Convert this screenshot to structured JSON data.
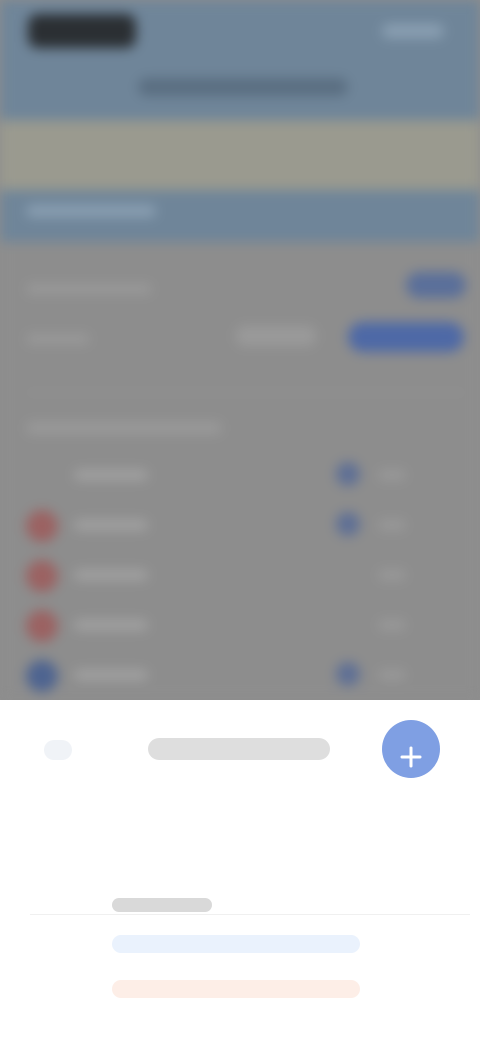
{
  "header": {
    "title": ""
  },
  "sheet": {
    "title": "",
    "section_label": "",
    "fab_icon": "plus-icon"
  },
  "list": {
    "rows": [
      {
        "avatar_color": "#8d8d8d",
        "toggle_color": "#5e6f95"
      },
      {
        "avatar_color": "#9b6262",
        "toggle_color": "#5e6f95"
      },
      {
        "avatar_color": "#9b6262",
        "toggle_color": "#8d8d8d"
      },
      {
        "avatar_color": "#9b6262",
        "toggle_color": "#8d8d8d"
      },
      {
        "avatar_color": "#4e6490",
        "toggle_color": "#5e6f95"
      }
    ]
  },
  "colors": {
    "accent": "#7f9fe3",
    "header_bg": "#6f8599",
    "overlay_bg": "#8e8e8e",
    "sheet_bg": "#ffffff"
  }
}
